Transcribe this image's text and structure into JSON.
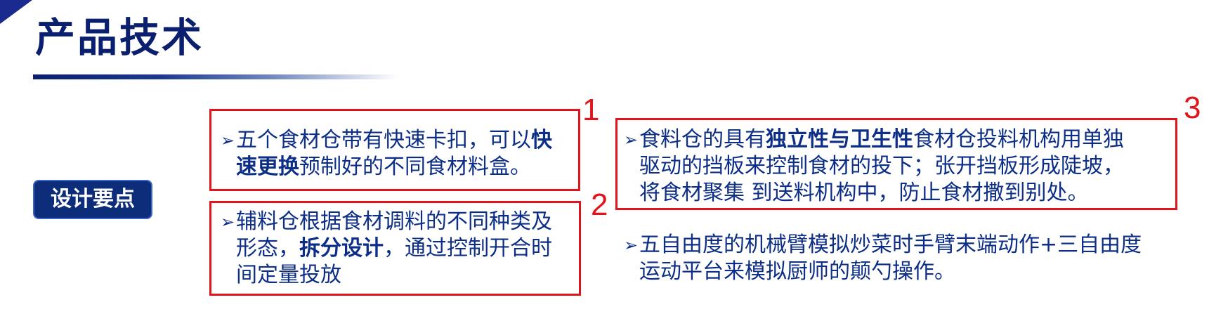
{
  "slide": {
    "title": "产品技术",
    "badge": "设计要点",
    "colors": {
      "title": "#0a1f6e",
      "text": "#0d2e87",
      "box_border": "#e0141b",
      "badge_bg": "#0d2c7a"
    },
    "icons": {
      "bullet": "arrow-bullet-icon",
      "corner": "corner-triangle-icon"
    },
    "points": [
      {
        "number": "1",
        "bullet": "➢",
        "line1_a": "五个食材仓带有快速卡扣，可以",
        "line1_b": "快",
        "line2_a": "速更换",
        "line2_b": "预制好的不同食材料盒。"
      },
      {
        "number": "2",
        "bullet": "➢",
        "line1": "辅料仓根据食材调料的不同种类及",
        "line2_a": "形态，",
        "line2_b": "拆分设计",
        "line2_c": "，通过控制开合时",
        "line3": "间定量投放"
      },
      {
        "number": "3",
        "bullet": "➢",
        "line1_a": "食料仓的具有",
        "line1_b": "独立性与卫生性",
        "line1_c": "食材仓投料机构用单独",
        "line2": "驱动的挡板来控制食材的投下；张开挡板形成陡坡，",
        "line3": "将食材聚集 到送料机构中，防止食材撒到别处。"
      },
      {
        "bullet": "➢",
        "line1": " 五自由度的机械臂模拟炒菜时手臂末端动作+三自由度",
        "line2": "运动平台来模拟厨师的颠勺操作。"
      }
    ]
  }
}
